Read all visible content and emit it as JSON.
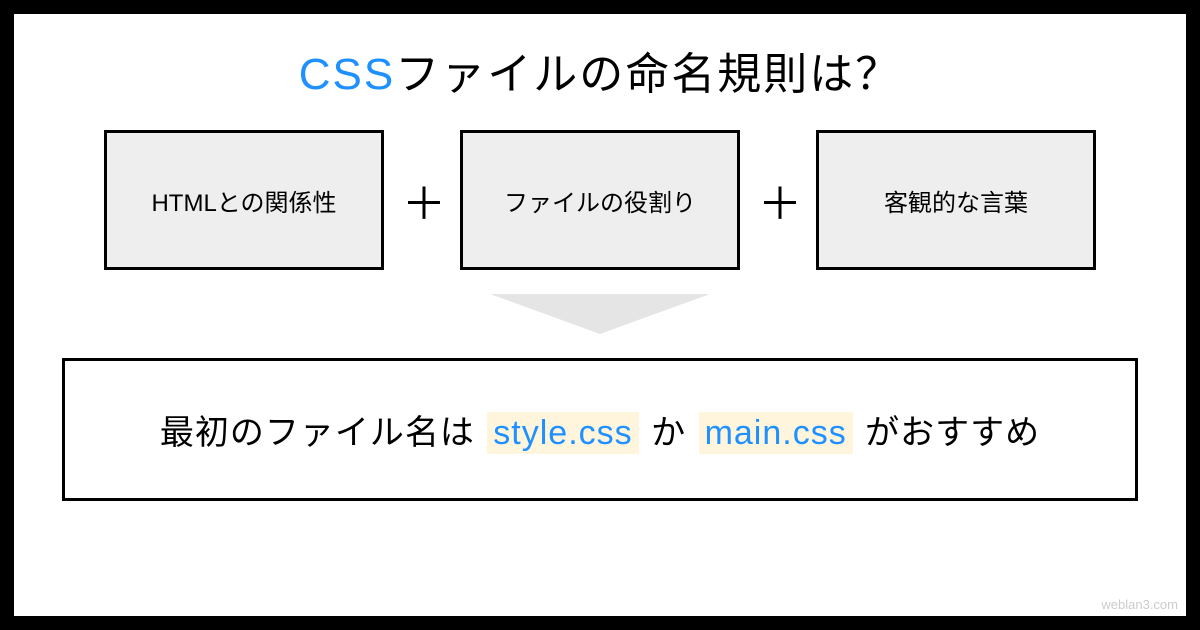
{
  "title": {
    "highlight": "CSS",
    "rest": "ファイルの命名規則は？"
  },
  "factors": {
    "box1": "HTMLとの関係性",
    "box2": "ファイルの役割り",
    "box3": "客観的な言葉"
  },
  "plus": "＋",
  "result": {
    "prefix": "最初のファイル名は",
    "file1": "style.css",
    "middle": "か",
    "file2": "main.css",
    "suffix": "がおすすめ"
  },
  "watermark": "weblan3.com"
}
